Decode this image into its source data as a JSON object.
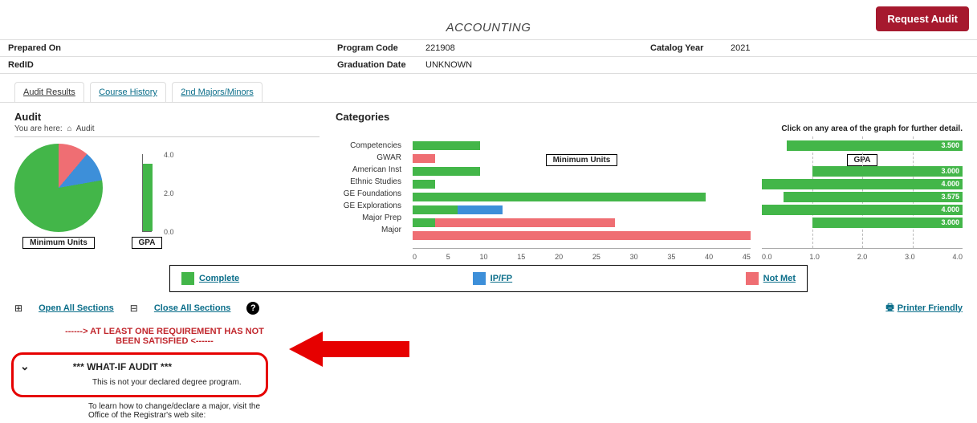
{
  "header": {
    "request_audit_label": "Request Audit",
    "page_title": "ACCOUNTING",
    "prepared_on_label": "Prepared On",
    "prepared_on_value": "",
    "program_code_label": "Program Code",
    "program_code_value": "221908",
    "catalog_year_label": "Catalog Year",
    "catalog_year_value": "2021",
    "redid_label": "RedID",
    "redid_value": "",
    "grad_date_label": "Graduation Date",
    "grad_date_value": "UNKNOWN"
  },
  "tabs": {
    "audit_results": "Audit Results",
    "course_history": "Course History",
    "second_majors": "2nd Majors/Minors"
  },
  "audit_panel": {
    "title": "Audit",
    "crumb_prefix": "You are here:",
    "crumb_current": "Audit",
    "min_units_caption": "Minimum Units",
    "gpa_caption": "GPA",
    "gpa_axis_top": "4.0",
    "gpa_axis_mid": "2.0",
    "gpa_axis_bot": "0.0"
  },
  "categories_panel": {
    "title": "Categories",
    "instruction": "Click on any area of the graph for further detail.",
    "min_units_caption": "Minimum Units",
    "gpa_caption": "GPA",
    "labels": [
      "Competencies",
      "GWAR",
      "American Inst",
      "Ethnic Studies",
      "GE Foundations",
      "GE Explorations",
      "Major Prep",
      "Major"
    ],
    "unit_ticks": [
      "0",
      "5",
      "10",
      "15",
      "20",
      "25",
      "30",
      "35",
      "40",
      "45"
    ],
    "gpa_ticks": [
      "0.0",
      "1.0",
      "2.0",
      "3.0",
      "4.0"
    ],
    "gpa_values": [
      "3.500",
      "",
      "3.000",
      "4.000",
      "3.575",
      "4.000",
      "3.000",
      ""
    ]
  },
  "legend": {
    "complete": "Complete",
    "ipfp": "IP/FP",
    "not_met": "Not Met"
  },
  "controls": {
    "open_all": "Open All Sections",
    "close_all": "Close All Sections",
    "printer": "Printer Friendly"
  },
  "alert": {
    "warn_text": "------> AT LEAST ONE REQUIREMENT HAS NOT BEEN SATISFIED <------",
    "whatif_title": "*** WHAT-IF AUDIT ***",
    "whatif_sub": "This is not your declared degree program.",
    "bottom_note": "To learn how to change/declare a major, visit the Office of the Registrar's web site:"
  },
  "chart_data": [
    {
      "type": "pie",
      "title": "Minimum Units",
      "series": [
        {
          "name": "Not Met",
          "value": 11
        },
        {
          "name": "IP/FP",
          "value": 11
        },
        {
          "name": "Complete",
          "value": 78
        }
      ]
    },
    {
      "type": "bar",
      "title": "GPA (overall)",
      "categories": [
        "GPA"
      ],
      "values": [
        3.5
      ],
      "ylim": [
        0,
        4
      ]
    },
    {
      "type": "bar",
      "title": "Minimum Units by Category",
      "xlabel": "Minimum Units",
      "ylabel": "",
      "ylim": [
        0,
        45
      ],
      "categories": [
        "Competencies",
        "GWAR",
        "American Inst",
        "Ethnic Studies",
        "GE Foundations",
        "GE Explorations",
        "Major Prep",
        "Major"
      ],
      "series": [
        {
          "name": "Complete",
          "values": [
            9,
            0,
            9,
            3,
            39,
            6,
            3,
            0
          ]
        },
        {
          "name": "IP/FP",
          "values": [
            0,
            0,
            0,
            0,
            0,
            6,
            0,
            0
          ]
        },
        {
          "name": "Not Met",
          "values": [
            0,
            3,
            0,
            0,
            0,
            0,
            24,
            45
          ]
        }
      ]
    },
    {
      "type": "bar",
      "title": "GPA by Category",
      "xlabel": "GPA",
      "ylim": [
        0,
        4
      ],
      "categories": [
        "Competencies",
        "GWAR",
        "American Inst",
        "Ethnic Studies",
        "GE Foundations",
        "GE Explorations",
        "Major Prep",
        "Major"
      ],
      "values": [
        3.5,
        null,
        3.0,
        4.0,
        3.575,
        4.0,
        3.0,
        null
      ]
    }
  ]
}
